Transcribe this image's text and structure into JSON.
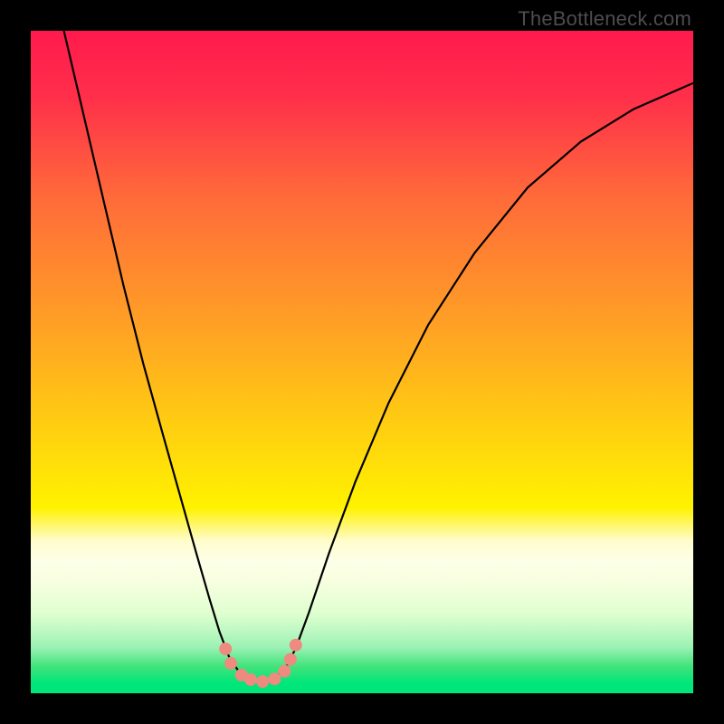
{
  "watermark": "TheBottleneck.com",
  "colors": {
    "frame": "#000000",
    "gradient_stops": [
      {
        "offset": 0.0,
        "color": "#ff1a4d"
      },
      {
        "offset": 0.1,
        "color": "#ff2f4a"
      },
      {
        "offset": 0.25,
        "color": "#ff6a3a"
      },
      {
        "offset": 0.45,
        "color": "#ffa224"
      },
      {
        "offset": 0.62,
        "color": "#ffd50e"
      },
      {
        "offset": 0.72,
        "color": "#fff200"
      },
      {
        "offset": 0.77,
        "color": "#fffccc"
      },
      {
        "offset": 0.8,
        "color": "#fdffe8"
      },
      {
        "offset": 0.83,
        "color": "#f8ffe0"
      },
      {
        "offset": 0.88,
        "color": "#dfffd0"
      },
      {
        "offset": 0.93,
        "color": "#9df2b5"
      },
      {
        "offset": 0.96,
        "color": "#40e37a"
      },
      {
        "offset": 0.985,
        "color": "#00e67a"
      },
      {
        "offset": 1.0,
        "color": "#00e67a"
      }
    ],
    "curve": "#000000",
    "dots": "#ef8a80"
  },
  "chart_data": {
    "type": "line",
    "title": "",
    "xlabel": "",
    "ylabel": "",
    "series": [
      {
        "name": "bottleneck-curve",
        "points": [
          {
            "x": 0.05,
            "y": 1.0
          },
          {
            "x": 0.08,
            "y": 0.87
          },
          {
            "x": 0.11,
            "y": 0.74
          },
          {
            "x": 0.14,
            "y": 0.61
          },
          {
            "x": 0.17,
            "y": 0.49
          },
          {
            "x": 0.2,
            "y": 0.38
          },
          {
            "x": 0.225,
            "y": 0.29
          },
          {
            "x": 0.25,
            "y": 0.2
          },
          {
            "x": 0.27,
            "y": 0.13
          },
          {
            "x": 0.285,
            "y": 0.08
          },
          {
            "x": 0.3,
            "y": 0.04
          },
          {
            "x": 0.315,
            "y": 0.018
          },
          {
            "x": 0.33,
            "y": 0.008
          },
          {
            "x": 0.35,
            "y": 0.004
          },
          {
            "x": 0.37,
            "y": 0.01
          },
          {
            "x": 0.385,
            "y": 0.025
          },
          {
            "x": 0.4,
            "y": 0.055
          },
          {
            "x": 0.42,
            "y": 0.11
          },
          {
            "x": 0.45,
            "y": 0.2
          },
          {
            "x": 0.49,
            "y": 0.31
          },
          {
            "x": 0.54,
            "y": 0.43
          },
          {
            "x": 0.6,
            "y": 0.55
          },
          {
            "x": 0.67,
            "y": 0.66
          },
          {
            "x": 0.75,
            "y": 0.76
          },
          {
            "x": 0.83,
            "y": 0.83
          },
          {
            "x": 0.91,
            "y": 0.88
          },
          {
            "x": 1.0,
            "y": 0.92
          }
        ]
      }
    ],
    "xlim": [
      0,
      1
    ],
    "ylim": [
      0,
      1
    ],
    "dots": [
      {
        "x": 0.294,
        "y": 0.054
      },
      {
        "x": 0.302,
        "y": 0.032
      },
      {
        "x": 0.318,
        "y": 0.014
      },
      {
        "x": 0.332,
        "y": 0.007
      },
      {
        "x": 0.35,
        "y": 0.004
      },
      {
        "x": 0.368,
        "y": 0.008
      },
      {
        "x": 0.383,
        "y": 0.02
      },
      {
        "x": 0.392,
        "y": 0.038
      },
      {
        "x": 0.4,
        "y": 0.06
      }
    ]
  }
}
